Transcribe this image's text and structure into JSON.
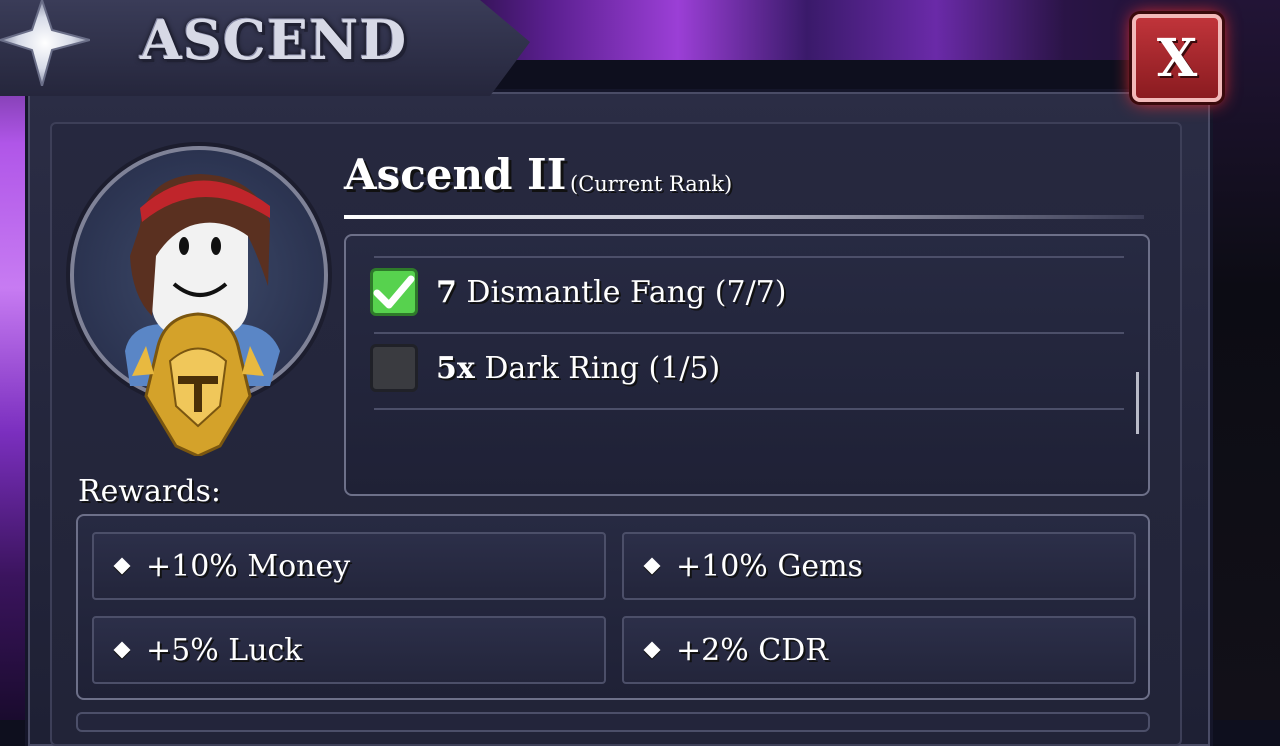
{
  "window": {
    "title": "ASCEND",
    "close_label": "X"
  },
  "rank": {
    "name": "Ascend II",
    "status": "(Current Rank)"
  },
  "requirements": [
    {
      "count": "7",
      "text": "Dismantle Fang (7/7)",
      "done": true
    },
    {
      "count": "5x",
      "text": "Dark Ring (1/5)",
      "done": false
    }
  ],
  "rewards": {
    "label": "Rewards:",
    "items": [
      {
        "text": "+10% Money"
      },
      {
        "text": "+10% Gems"
      },
      {
        "text": "+5% Luck"
      },
      {
        "text": "+2% CDR"
      }
    ]
  },
  "icons": {
    "title": "sparkle-star-icon",
    "close": "close-icon",
    "check": "checkmark-icon",
    "bullet": "diamond-bullet-icon",
    "rank_badge": "golden-helmet-emblem-icon"
  },
  "colors": {
    "panel": "#25273d",
    "check_green": "#57d24e",
    "close_red": "#b3262c",
    "text": "#ffffff"
  }
}
